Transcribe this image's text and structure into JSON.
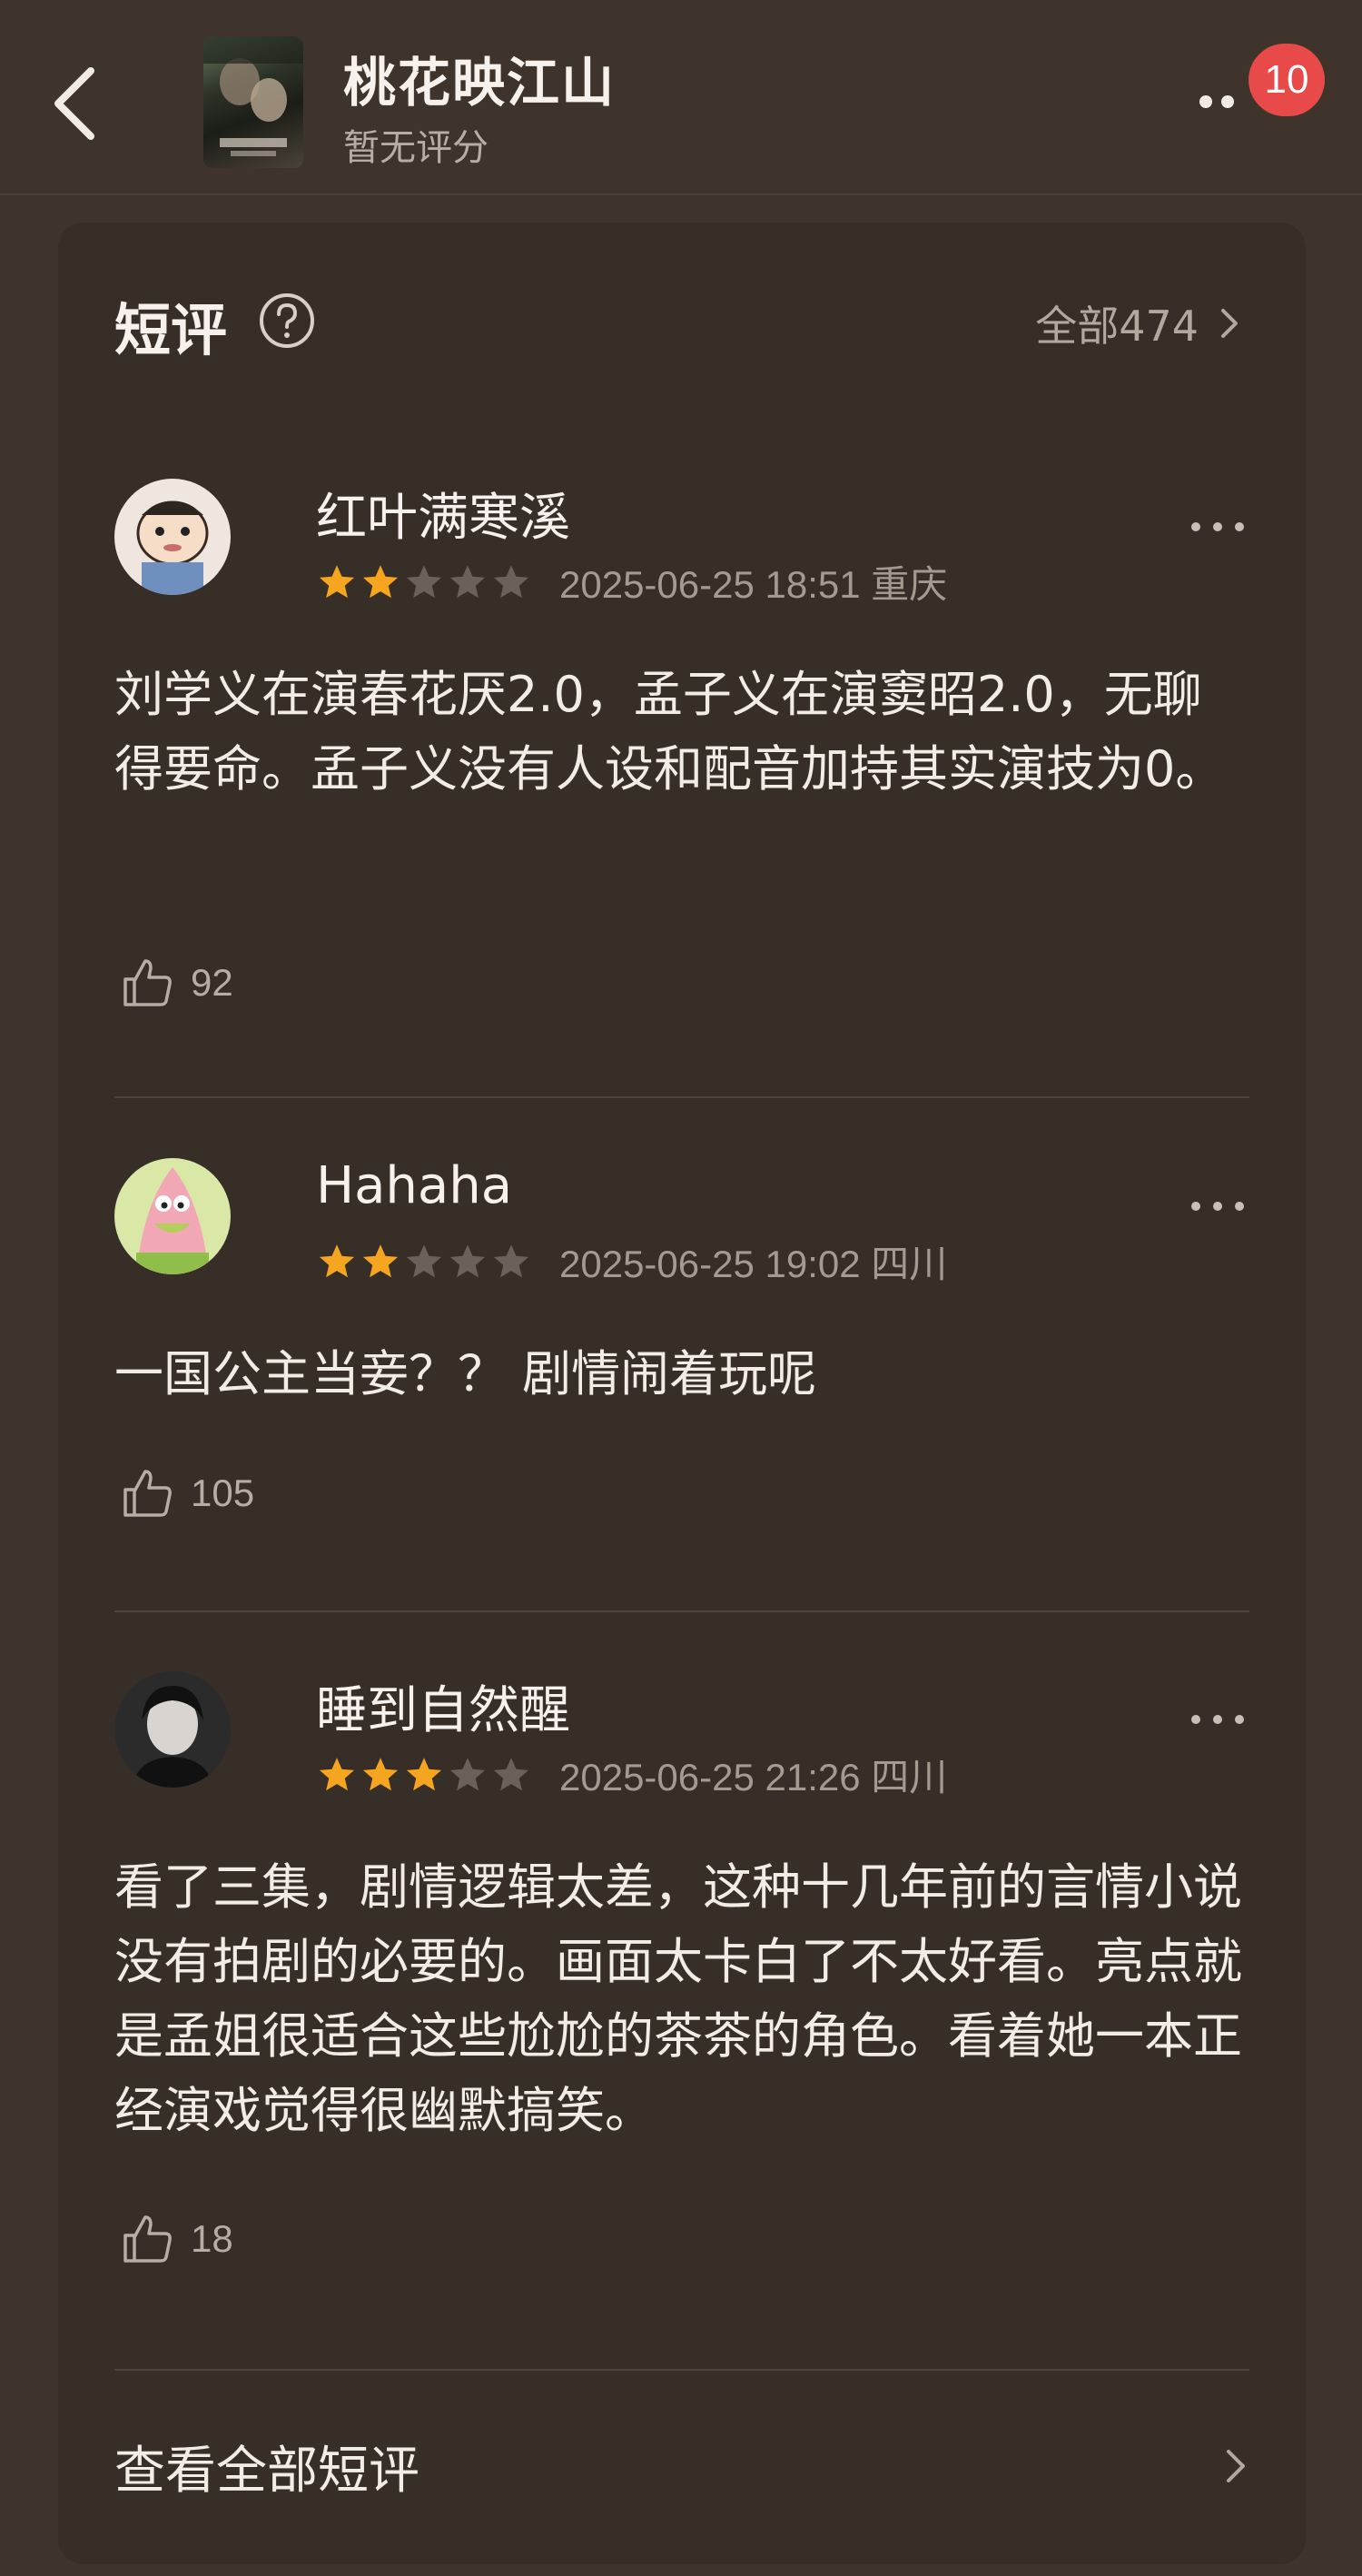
{
  "header": {
    "title": "桃花映江山",
    "subtitle": "暂无评分",
    "badge_count": "10"
  },
  "section": {
    "title": "短评",
    "all_label": "全部474"
  },
  "reviews": [
    {
      "username": "红叶满寒溪",
      "rating": 2,
      "max_rating": 5,
      "datetime": "2025-06-25 18:51",
      "location": "重庆",
      "text": "刘学义在演春花厌2.0，孟子义在演窦昭2.0，无聊得要命。孟子义没有人设和配音加持其实演技为0。",
      "likes": "92"
    },
    {
      "username": "Hahaha",
      "rating": 2,
      "max_rating": 5,
      "datetime": "2025-06-25 19:02",
      "location": "四川",
      "text": "一国公主当妾？？ 剧情闹着玩呢",
      "likes": "105"
    },
    {
      "username": "睡到自然醒",
      "rating": 3,
      "max_rating": 5,
      "datetime": "2025-06-25 21:26",
      "location": "四川",
      "text": "看了三集，剧情逻辑太差，这种十几年前的言情小说没有拍剧的必要的。画面太卡白了不太好看。亮点就是孟姐很适合这些尬尬的茶茶的角色。看着她一本正经演戏觉得很幽默搞笑。",
      "likes": "18"
    }
  ],
  "footer": {
    "view_all_label": "查看全部短评"
  },
  "colors": {
    "background": "#3e342b",
    "card": "#372e27",
    "star_filled": "#f5a51f",
    "star_empty": "#6b6158",
    "badge": "#e84a4a"
  },
  "icons": [
    "back-arrow-icon",
    "more-dots-icon",
    "help-circle-icon",
    "chevron-right-icon",
    "thumbs-up-icon",
    "star-icon"
  ]
}
